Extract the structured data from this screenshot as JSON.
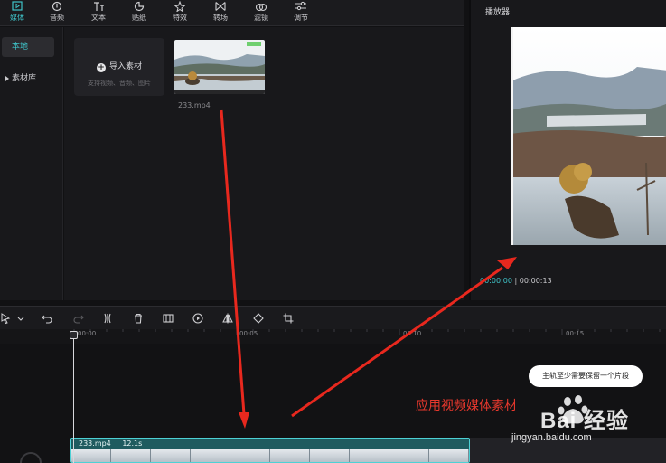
{
  "toolbar": {
    "tools": [
      {
        "label": "媒体",
        "icon": "media-icon",
        "active": true
      },
      {
        "label": "音频",
        "icon": "audio-icon"
      },
      {
        "label": "文本",
        "icon": "text-icon"
      },
      {
        "label": "贴纸",
        "icon": "sticker-icon"
      },
      {
        "label": "特效",
        "icon": "effects-icon"
      },
      {
        "label": "转场",
        "icon": "transition-icon"
      },
      {
        "label": "滤镜",
        "icon": "filter-icon"
      },
      {
        "label": "调节",
        "icon": "adjust-icon"
      }
    ]
  },
  "sidebar": {
    "items": [
      {
        "label": "本地",
        "active": true
      },
      {
        "label": "素材库",
        "active": false
      }
    ]
  },
  "media": {
    "import_label": "导入素材",
    "import_hint": "支持视频、音频、图片",
    "clip_name": "233.mp4"
  },
  "player": {
    "title": "播放器",
    "current_time": "00:00:00",
    "total_time": "00:00:13"
  },
  "timeline": {
    "ticks": [
      "00:00",
      "00:05",
      "00:10",
      "00:15"
    ],
    "track": {
      "name": "233.mp4",
      "duration": "12.1s"
    },
    "tooltip": "主轨至少需要保留一个片段"
  },
  "annotation": {
    "text": "应用视频媒体素材",
    "color": "#e8382d"
  },
  "watermark": {
    "brand": "Bai 经验",
    "url": "jingyan.baidu.com"
  },
  "colors": {
    "accent": "#3fc3c8",
    "background": "#18181b"
  }
}
